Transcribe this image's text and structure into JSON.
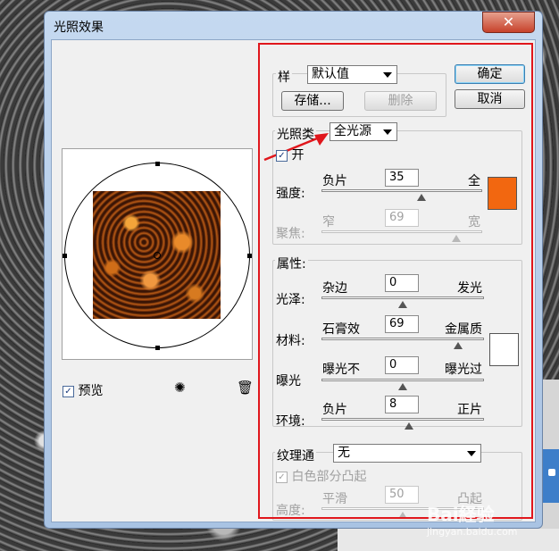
{
  "window": {
    "title": "光照效果",
    "close_label": "✕"
  },
  "colors": {
    "light_color": "#f26710",
    "material_color": "#ffffff",
    "highlight": "#e0161c"
  },
  "style": {
    "label": "样",
    "value": "默认值",
    "save_label": "存储...",
    "delete_label": "删除"
  },
  "buttons": {
    "ok": "确定",
    "cancel": "取消"
  },
  "light_type": {
    "label": "光照类",
    "value": "全光源",
    "on_label": "开",
    "intensity": {
      "label": "强度:",
      "min_label": "负片",
      "max_label": "全",
      "value": "35",
      "fraction": 0.62
    },
    "focus": {
      "label": "聚焦:",
      "min_label": "窄",
      "max_label": "宽",
      "value": "69",
      "fraction": 0.84
    }
  },
  "properties": {
    "label": "属性:",
    "gloss": {
      "label": "光泽:",
      "min_label": "杂边",
      "max_label": "发光",
      "value": "0",
      "fraction": 0.5
    },
    "material": {
      "label": "材料:",
      "min_label": "石膏效",
      "max_label": "金属质",
      "value": "69",
      "fraction": 0.84
    },
    "exposure": {
      "label": "曝光",
      "min_label": "曝光不",
      "max_label": "曝光过",
      "value": "0",
      "fraction": 0.5
    },
    "ambience": {
      "label": "环境:",
      "min_label": "负片",
      "max_label": "正片",
      "value": "8",
      "fraction": 0.54
    }
  },
  "texture": {
    "label": "纹理通",
    "value": "无",
    "white_high_label": "白色部分凸起",
    "height": {
      "label": "高度:",
      "min_label": "平滑",
      "max_label": "凸起",
      "value": "50",
      "fraction": 0.5
    }
  },
  "preview": {
    "label": "预览"
  },
  "watermark": {
    "logo": "Bai経验",
    "url": "jingyan.baidu.com"
  },
  "icons": {
    "bulb": "light-bulb-icon",
    "trash": "trash-icon",
    "check": "check-icon"
  }
}
